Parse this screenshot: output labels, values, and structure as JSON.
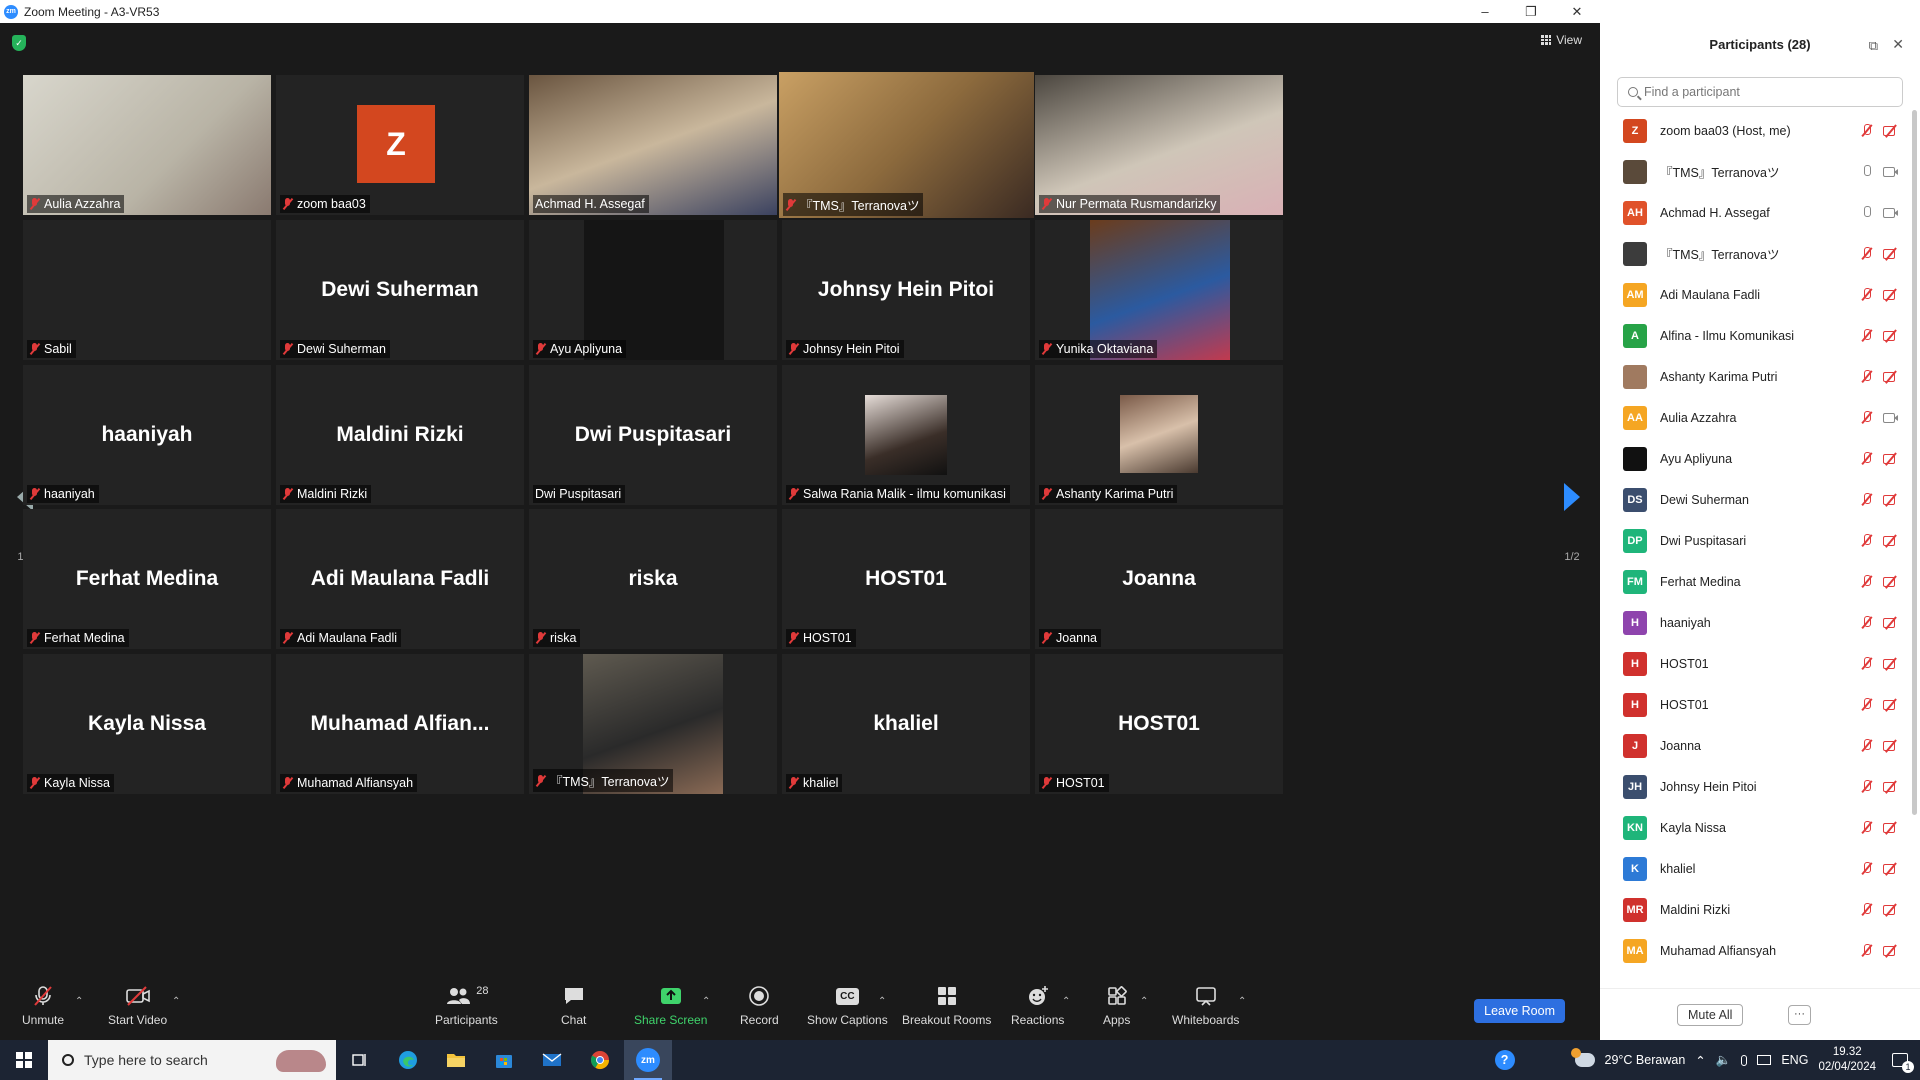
{
  "window": {
    "title": "Zoom Meeting - A3-VR53",
    "controls": [
      "–",
      "❐",
      "✕"
    ]
  },
  "meeting": {
    "view_label": "View",
    "page_indicator_left": "1/2",
    "page_indicator_right": "1/2"
  },
  "tiles": [
    {
      "name": "Aulia Azzahra",
      "big": "",
      "muted": true
    },
    {
      "name": "zoom baa03",
      "big": "",
      "avatar": "Z",
      "muted": true
    },
    {
      "name": "Achmad H. Assegaf",
      "big": "",
      "muted": false
    },
    {
      "name": "『TMS』Terranovaツ",
      "big": "",
      "muted": true,
      "active": true
    },
    {
      "name": "Nur Permata Rusmandarizky",
      "big": "",
      "muted": true
    },
    {
      "name": "Sabil",
      "big": "",
      "muted": true
    },
    {
      "name": "Dewi Suherman",
      "big": "Dewi Suherman",
      "muted": true
    },
    {
      "name": "Ayu Apliyuna",
      "big": "",
      "muted": true
    },
    {
      "name": "Johnsy Hein Pitoi",
      "big": "Johnsy Hein Pitoi",
      "muted": true
    },
    {
      "name": "Yunika Oktaviana",
      "big": "",
      "muted": true
    },
    {
      "name": "haaniyah",
      "big": "haaniyah",
      "muted": true
    },
    {
      "name": "Maldini Rizki",
      "big": "Maldini Rizki",
      "muted": true
    },
    {
      "name": "Dwi Puspitasari",
      "big": "Dwi Puspitasari",
      "muted": false
    },
    {
      "name": "Salwa Rania Malik - ilmu komunikasi",
      "big": "",
      "muted": true
    },
    {
      "name": "Ashanty Karima Putri",
      "big": "",
      "muted": true
    },
    {
      "name": "Ferhat Medina",
      "big": "Ferhat Medina",
      "muted": true
    },
    {
      "name": "Adi Maulana Fadli",
      "big": "Adi Maulana Fadli",
      "muted": true
    },
    {
      "name": "riska",
      "big": "riska",
      "muted": true
    },
    {
      "name": "HOST01",
      "big": "HOST01",
      "muted": true
    },
    {
      "name": "Joanna",
      "big": "Joanna",
      "muted": true
    },
    {
      "name": "Kayla Nissa",
      "big": "Kayla Nissa",
      "muted": true
    },
    {
      "name": "Muhamad Alfiansyah",
      "big": "Muhamad  Alfian...",
      "muted": true
    },
    {
      "name": "『TMS』Terranovaツ",
      "big": "",
      "muted": true
    },
    {
      "name": "khaliel",
      "big": "khaliel",
      "muted": true
    },
    {
      "name": "HOST01",
      "big": "HOST01",
      "muted": true
    }
  ],
  "toolbar": {
    "unmute": "Unmute",
    "start_video": "Start Video",
    "participants": "Participants",
    "participants_count": "28",
    "chat": "Chat",
    "share_screen": "Share Screen",
    "record": "Record",
    "show_captions": "Show Captions",
    "breakout_rooms": "Breakout Rooms",
    "reactions": "Reactions",
    "apps": "Apps",
    "whiteboards": "Whiteboards",
    "leave_room": "Leave Room",
    "captions_icon_text": "CC"
  },
  "sidebar": {
    "title": "Participants (28)",
    "search_placeholder": "Find a participant",
    "mute_all": "Mute All",
    "more": "···",
    "participants": [
      {
        "initials": "Z",
        "name": "zoom baa03 (Host, me)",
        "color": "#d3471f",
        "mic": "off",
        "cam": "off"
      },
      {
        "initials": "",
        "name": "『TMS』Terranovaツ",
        "color": "#5a4a3a",
        "mic": "on",
        "cam": "on"
      },
      {
        "initials": "AH",
        "name": "Achmad H. Assegaf",
        "color": "#e0522a",
        "mic": "on",
        "cam": "on"
      },
      {
        "initials": "",
        "name": "『TMS』Terranovaツ",
        "color": "#3c3c3c",
        "mic": "off",
        "cam": "off"
      },
      {
        "initials": "AM",
        "name": "Adi Maulana Fadli",
        "color": "#f5a623",
        "mic": "off",
        "cam": "off"
      },
      {
        "initials": "A",
        "name": "Alfina - Ilmu Komunikasi",
        "color": "#27a347",
        "mic": "off",
        "cam": "off"
      },
      {
        "initials": "",
        "name": "Ashanty Karima Putri",
        "color": "#a07a60",
        "mic": "off",
        "cam": "off"
      },
      {
        "initials": "AA",
        "name": "Aulia Azzahra",
        "color": "#f5a623",
        "mic": "off",
        "cam": "on"
      },
      {
        "initials": "",
        "name": "Ayu Apliyuna",
        "color": "#111111",
        "mic": "off",
        "cam": "off"
      },
      {
        "initials": "DS",
        "name": "Dewi Suherman",
        "color": "#3b4e6e",
        "mic": "off",
        "cam": "off"
      },
      {
        "initials": "DP",
        "name": "Dwi Puspitasari",
        "color": "#1fb57a",
        "mic": "off",
        "cam": "off"
      },
      {
        "initials": "FM",
        "name": "Ferhat Medina",
        "color": "#1fb57a",
        "mic": "off",
        "cam": "off"
      },
      {
        "initials": "H",
        "name": "haaniyah",
        "color": "#8e44ad",
        "mic": "off",
        "cam": "off"
      },
      {
        "initials": "H",
        "name": "HOST01",
        "color": "#d0312d",
        "mic": "off",
        "cam": "off"
      },
      {
        "initials": "H",
        "name": "HOST01",
        "color": "#d0312d",
        "mic": "off",
        "cam": "off"
      },
      {
        "initials": "J",
        "name": "Joanna",
        "color": "#d0312d",
        "mic": "off",
        "cam": "off"
      },
      {
        "initials": "JH",
        "name": "Johnsy Hein Pitoi",
        "color": "#3b4e6e",
        "mic": "off",
        "cam": "off"
      },
      {
        "initials": "KN",
        "name": "Kayla Nissa",
        "color": "#1fb57a",
        "mic": "off",
        "cam": "off"
      },
      {
        "initials": "K",
        "name": "khaliel",
        "color": "#2d7ad6",
        "mic": "off",
        "cam": "off"
      },
      {
        "initials": "MR",
        "name": "Maldini Rizki",
        "color": "#d0312d",
        "mic": "off",
        "cam": "off"
      },
      {
        "initials": "MA",
        "name": "Muhamad Alfiansyah",
        "color": "#f5a623",
        "mic": "off",
        "cam": "off"
      }
    ]
  },
  "taskbar": {
    "search_placeholder": "Type here to search",
    "weather": "29°C  Berawan",
    "language": "ENG",
    "time": "19.32",
    "date": "02/04/2024",
    "notification_count": "1"
  }
}
